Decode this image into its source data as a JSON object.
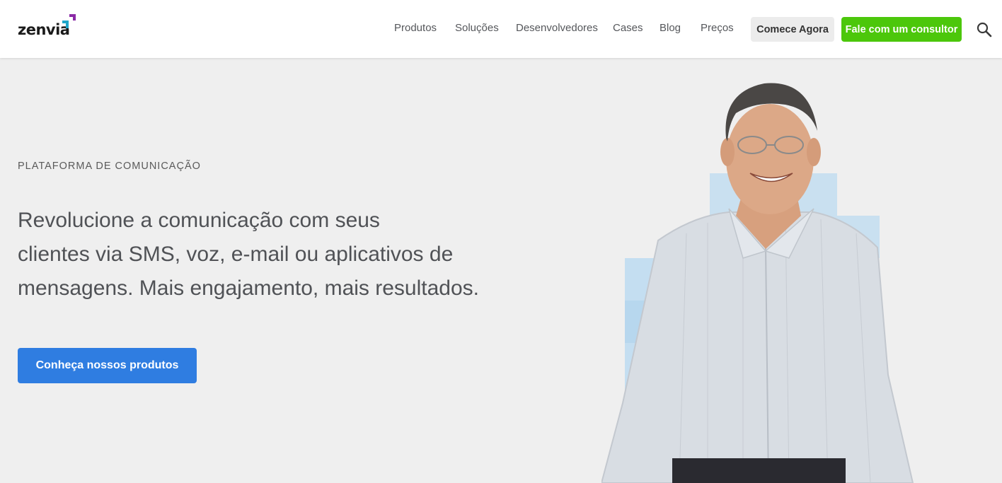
{
  "header": {
    "logo_text": "zenvia",
    "nav": [
      "Produtos",
      "Soluções",
      "Desenvolvedores",
      "Cases",
      "Blog",
      "Preços"
    ],
    "start_button": "Comece Agora",
    "consult_button": "Fale com um consultor",
    "search_icon": "search-icon"
  },
  "hero": {
    "eyebrow": "PLATAFORMA DE COMUNICAÇÃO",
    "headline_lines": [
      "Revolucione a comunicação com seus",
      "clientes via SMS, voz, e-mail ou aplicativos de",
      "mensagens. Mais engajamento, mais resultados."
    ],
    "cta": "Conheça nossos produtos",
    "image": "smiling-man-portrait"
  },
  "colors": {
    "background": "#efefef",
    "consult_button": "#4cc70b",
    "cta_button": "#2f7de1",
    "logo_purple": "#8b2aa6",
    "logo_teal": "#1fa6c9"
  }
}
